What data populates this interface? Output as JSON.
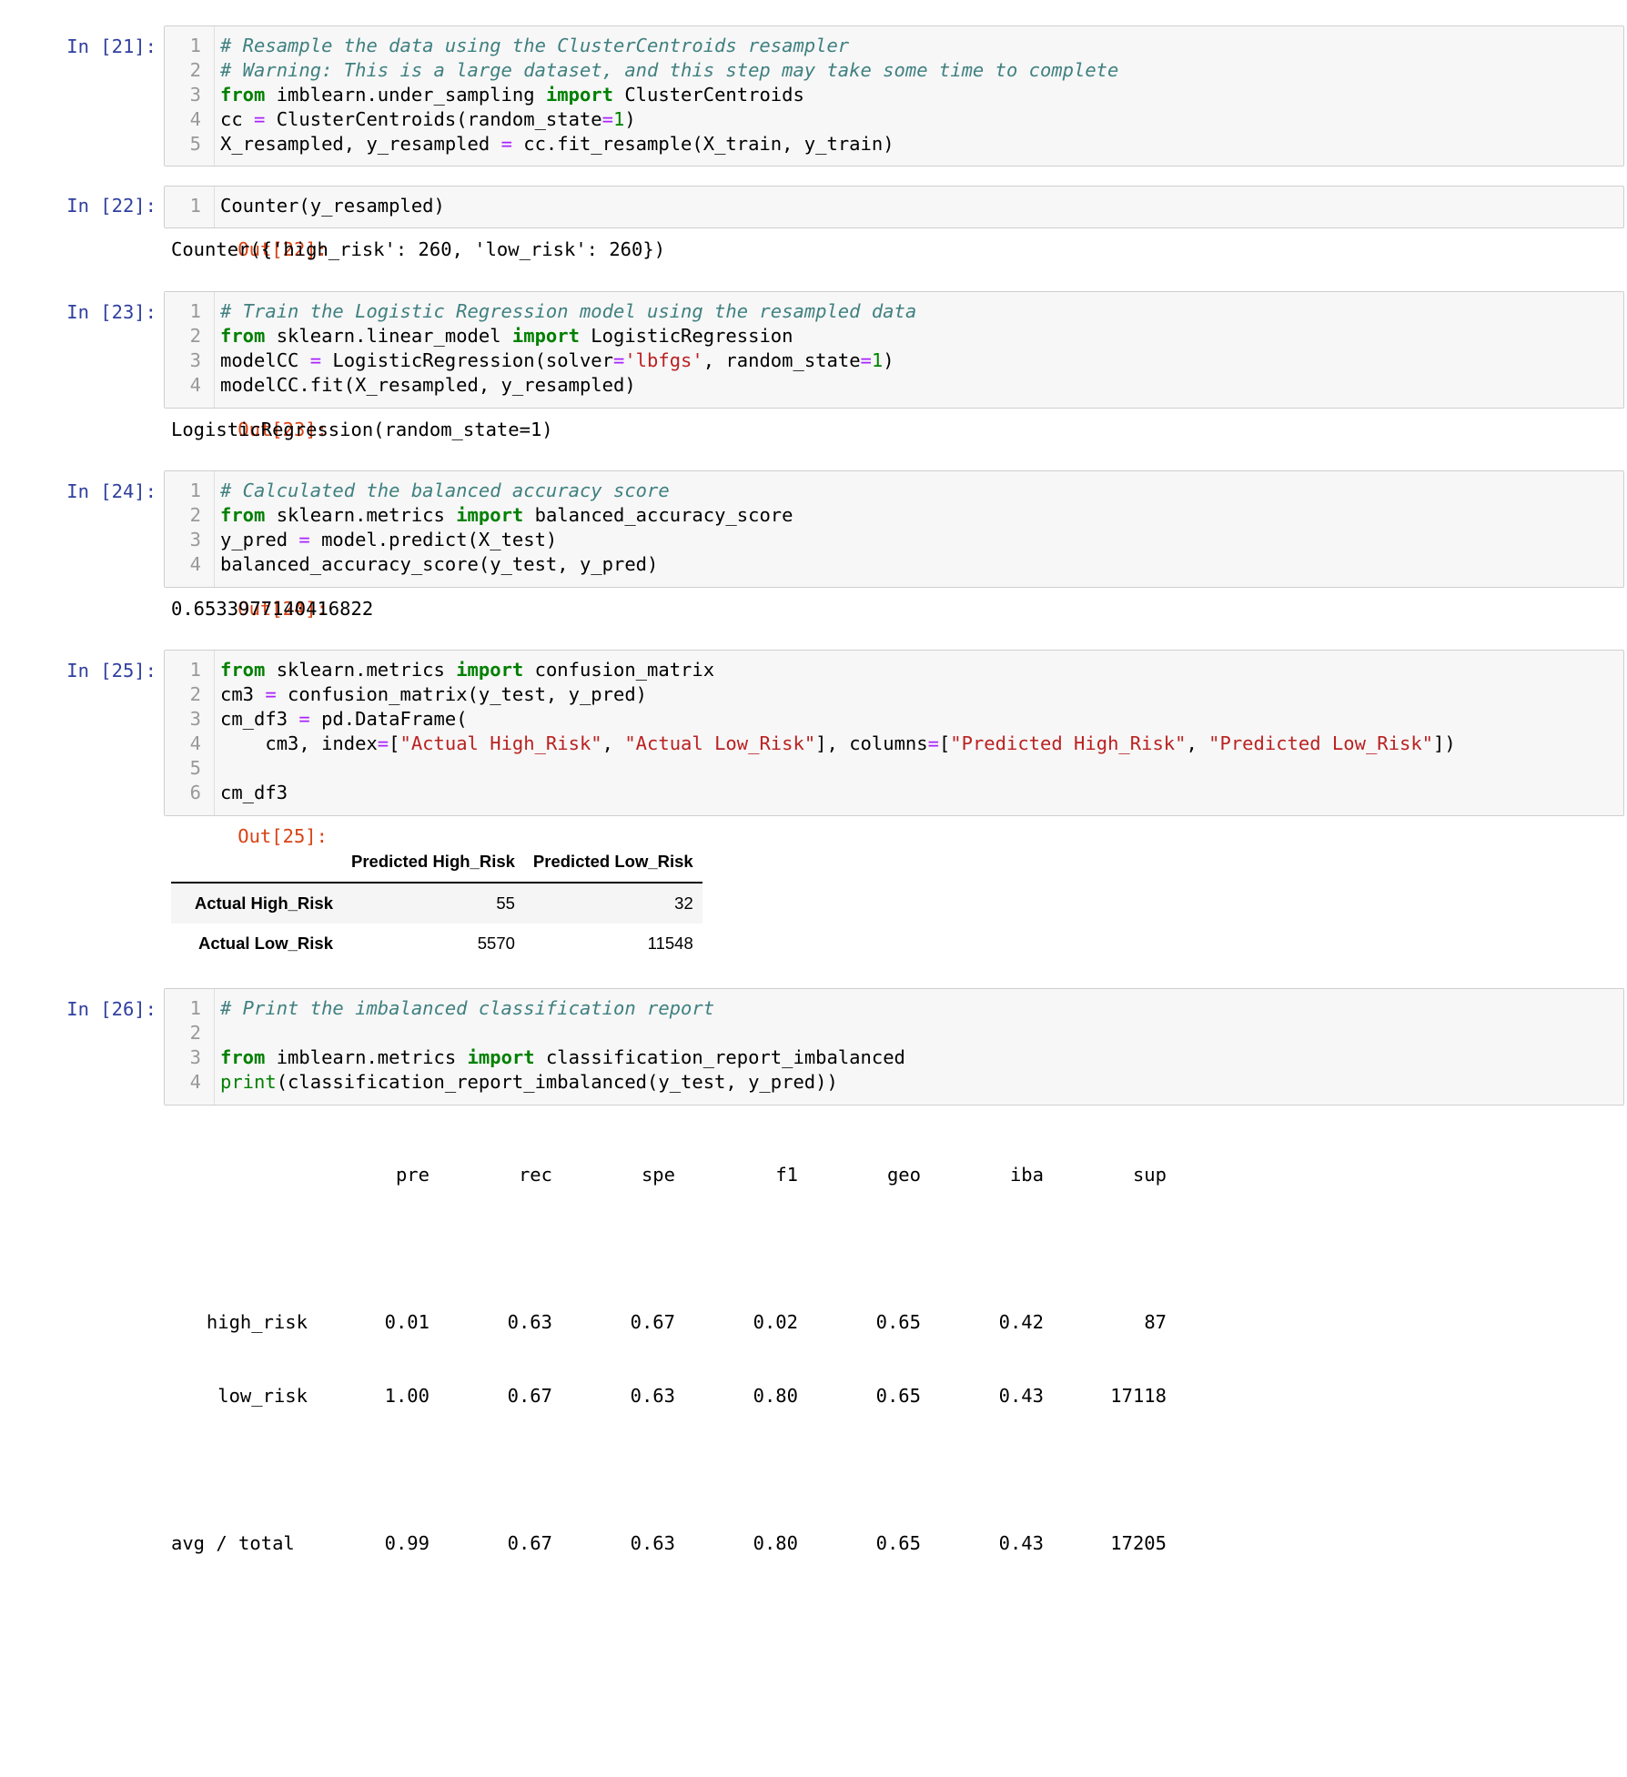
{
  "cells": {
    "c21": {
      "prompt": "In [21]:",
      "lines": [
        {
          "n": "1",
          "parts": [
            {
              "c": "cm",
              "t": "# Resample the data using the ClusterCentroids resampler"
            }
          ]
        },
        {
          "n": "2",
          "parts": [
            {
              "c": "cm",
              "t": "# Warning: This is a large dataset, and this step may take some time to complete"
            }
          ]
        },
        {
          "n": "3",
          "parts": [
            {
              "c": "kw",
              "t": "from"
            },
            {
              "c": "",
              "t": " imblearn.under_sampling "
            },
            {
              "c": "kw",
              "t": "import"
            },
            {
              "c": "",
              "t": " ClusterCentroids"
            }
          ]
        },
        {
          "n": "4",
          "parts": [
            {
              "c": "",
              "t": "cc "
            },
            {
              "c": "op",
              "t": "="
            },
            {
              "c": "",
              "t": " ClusterCentroids(random_state"
            },
            {
              "c": "op",
              "t": "="
            },
            {
              "c": "nm",
              "t": "1"
            },
            {
              "c": "",
              "t": ")"
            }
          ]
        },
        {
          "n": "5",
          "parts": [
            {
              "c": "",
              "t": "X_resampled, y_resampled "
            },
            {
              "c": "op",
              "t": "="
            },
            {
              "c": "",
              "t": " cc.fit_resample(X_train, y_train)"
            }
          ]
        }
      ]
    },
    "c22": {
      "prompt": "In [22]:",
      "lines": [
        {
          "n": "1",
          "parts": [
            {
              "c": "",
              "t": "Counter(y_resampled)"
            }
          ]
        }
      ],
      "out_prompt": "Out[22]:",
      "output": "Counter({'high_risk': 260, 'low_risk': 260})"
    },
    "c23": {
      "prompt": "In [23]:",
      "lines": [
        {
          "n": "1",
          "parts": [
            {
              "c": "cm",
              "t": "# Train the Logistic Regression model using the resampled data"
            }
          ]
        },
        {
          "n": "2",
          "parts": [
            {
              "c": "kw",
              "t": "from"
            },
            {
              "c": "",
              "t": " sklearn.linear_model "
            },
            {
              "c": "kw",
              "t": "import"
            },
            {
              "c": "",
              "t": " LogisticRegression"
            }
          ]
        },
        {
          "n": "3",
          "parts": [
            {
              "c": "",
              "t": "modelCC "
            },
            {
              "c": "op",
              "t": "="
            },
            {
              "c": "",
              "t": " LogisticRegression(solver"
            },
            {
              "c": "op",
              "t": "="
            },
            {
              "c": "st",
              "t": "'lbfgs'"
            },
            {
              "c": "",
              "t": ", random_state"
            },
            {
              "c": "op",
              "t": "="
            },
            {
              "c": "nm",
              "t": "1"
            },
            {
              "c": "",
              "t": ")"
            }
          ]
        },
        {
          "n": "4",
          "parts": [
            {
              "c": "",
              "t": "modelCC.fit(X_resampled, y_resampled)"
            }
          ]
        }
      ],
      "out_prompt": "Out[23]:",
      "output": "LogisticRegression(random_state=1)"
    },
    "c24": {
      "prompt": "In [24]:",
      "lines": [
        {
          "n": "1",
          "parts": [
            {
              "c": "cm",
              "t": "# Calculated the balanced accuracy score"
            }
          ]
        },
        {
          "n": "2",
          "parts": [
            {
              "c": "kw",
              "t": "from"
            },
            {
              "c": "",
              "t": " sklearn.metrics "
            },
            {
              "c": "kw",
              "t": "import"
            },
            {
              "c": "",
              "t": " balanced_accuracy_score"
            }
          ]
        },
        {
          "n": "3",
          "parts": [
            {
              "c": "",
              "t": "y_pred "
            },
            {
              "c": "op",
              "t": "="
            },
            {
              "c": "",
              "t": " model.predict(X_test)"
            }
          ]
        },
        {
          "n": "4",
          "parts": [
            {
              "c": "",
              "t": "balanced_accuracy_score(y_test, y_pred)"
            }
          ]
        }
      ],
      "out_prompt": "Out[24]:",
      "output": "0.6533977140416822"
    },
    "c25": {
      "prompt": "In [25]:",
      "lines": [
        {
          "n": "1",
          "parts": [
            {
              "c": "kw",
              "t": "from"
            },
            {
              "c": "",
              "t": " sklearn.metrics "
            },
            {
              "c": "kw",
              "t": "import"
            },
            {
              "c": "",
              "t": " confusion_matrix"
            }
          ]
        },
        {
          "n": "2",
          "parts": [
            {
              "c": "",
              "t": "cm3 "
            },
            {
              "c": "op",
              "t": "="
            },
            {
              "c": "",
              "t": " confusion_matrix(y_test, y_pred)"
            }
          ]
        },
        {
          "n": "3",
          "parts": [
            {
              "c": "",
              "t": "cm_df3 "
            },
            {
              "c": "op",
              "t": "="
            },
            {
              "c": "",
              "t": " pd.DataFrame("
            }
          ]
        },
        {
          "n": "4",
          "parts": [
            {
              "c": "",
              "t": "    cm3, index"
            },
            {
              "c": "op",
              "t": "="
            },
            {
              "c": "",
              "t": "["
            },
            {
              "c": "st",
              "t": "\"Actual High_Risk\""
            },
            {
              "c": "",
              "t": ", "
            },
            {
              "c": "st",
              "t": "\"Actual Low_Risk\""
            },
            {
              "c": "",
              "t": "], columns"
            },
            {
              "c": "op",
              "t": "="
            },
            {
              "c": "",
              "t": "["
            },
            {
              "c": "st",
              "t": "\"Predicted High_Risk\""
            },
            {
              "c": "",
              "t": ", "
            },
            {
              "c": "st",
              "t": "\"Predicted Low_Risk\""
            },
            {
              "c": "",
              "t": "])"
            }
          ]
        },
        {
          "n": "5",
          "parts": []
        },
        {
          "n": "6",
          "parts": [
            {
              "c": "",
              "t": "cm_df3"
            }
          ]
        }
      ],
      "out_prompt": "Out[25]:",
      "table": {
        "columns": [
          "",
          "Predicted High_Risk",
          "Predicted Low_Risk"
        ],
        "rows": [
          {
            "index": "Actual High_Risk",
            "values": [
              "55",
              "32"
            ]
          },
          {
            "index": "Actual Low_Risk",
            "values": [
              "5570",
              "11548"
            ]
          }
        ]
      }
    },
    "c26": {
      "prompt": "In [26]:",
      "lines": [
        {
          "n": "1",
          "parts": [
            {
              "c": "cm",
              "t": "# Print the imbalanced classification report"
            }
          ]
        },
        {
          "n": "2",
          "parts": []
        },
        {
          "n": "3",
          "parts": [
            {
              "c": "kw",
              "t": "from"
            },
            {
              "c": "",
              "t": " imblearn.metrics "
            },
            {
              "c": "kw",
              "t": "import"
            },
            {
              "c": "",
              "t": " classification_report_imbalanced"
            }
          ]
        },
        {
          "n": "4",
          "parts": [
            {
              "c": "bi",
              "t": "print"
            },
            {
              "c": "",
              "t": "(classification_report_imbalanced(y_test, y_pred))"
            }
          ]
        }
      ],
      "report": {
        "header": [
          "pre",
          "rec",
          "spe",
          "f1",
          "geo",
          "iba",
          "sup"
        ],
        "rows": [
          {
            "label": "high_risk",
            "values": [
              "0.01",
              "0.63",
              "0.67",
              "0.02",
              "0.65",
              "0.42",
              "87"
            ]
          },
          {
            "label": "low_risk",
            "values": [
              "1.00",
              "0.67",
              "0.63",
              "0.80",
              "0.65",
              "0.43",
              "17118"
            ]
          },
          {
            "label": "avg / total",
            "values": [
              "0.99",
              "0.67",
              "0.63",
              "0.80",
              "0.65",
              "0.43",
              "17205"
            ]
          }
        ]
      }
    }
  }
}
